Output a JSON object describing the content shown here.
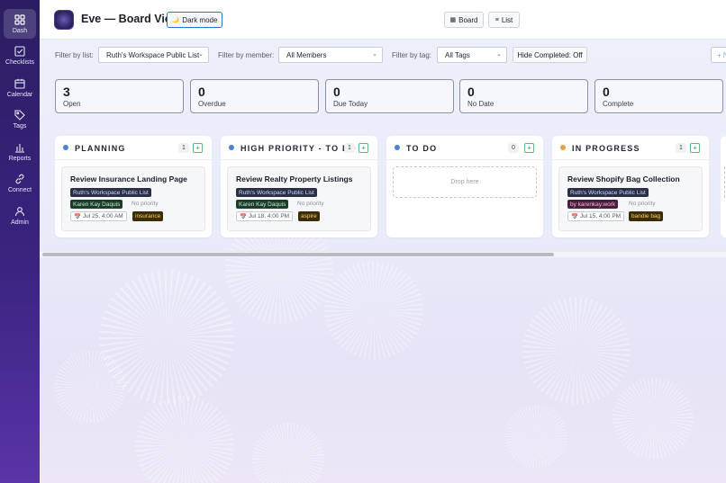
{
  "sidebar": {
    "items": [
      {
        "label": "Dash",
        "icon": "dashboard-icon",
        "active": true
      },
      {
        "label": "Checklists",
        "icon": "checklist-icon",
        "active": false
      },
      {
        "label": "Calendar",
        "icon": "calendar-icon",
        "active": false
      },
      {
        "label": "Tags",
        "icon": "tag-icon",
        "active": false
      },
      {
        "label": "Reports",
        "icon": "bar-chart-icon",
        "active": false
      },
      {
        "label": "Connect",
        "icon": "link-icon",
        "active": false
      },
      {
        "label": "Admin",
        "icon": "user-icon",
        "active": false
      }
    ]
  },
  "header": {
    "title": "Eve — Board View",
    "dark_mode_label": "Dark mode",
    "dark_mode_icon": "🌙",
    "board_label": "Board",
    "board_icon": "▦",
    "list_label": "List",
    "list_icon": "≡"
  },
  "filters": {
    "list_label": "Filter by list:",
    "list_value": "Ruth's Workspace Public List",
    "member_label": "Filter by member:",
    "member_value": "All Members",
    "tag_label": "Filter by tag:",
    "tag_value": "All Tags",
    "hide_completed_label": "Hide Completed: Off",
    "add_label": "+ N"
  },
  "stats": [
    {
      "value": "3",
      "label": "Open"
    },
    {
      "value": "0",
      "label": "Overdue"
    },
    {
      "value": "0",
      "label": "Due Today"
    },
    {
      "value": "0",
      "label": "No Date"
    },
    {
      "value": "0",
      "label": "Complete"
    }
  ],
  "columns": [
    {
      "title": "PLANNING",
      "count": "1",
      "dot_color": "#4a7fd6",
      "card": {
        "title": "Review Insurance Landing Page",
        "list": "Ruth's Workspace Public List",
        "member": "Karen Kay Daquis",
        "priority": "No priority",
        "date": "Jul 25, 4:00 AM",
        "tag": "insurance"
      }
    },
    {
      "title": "HIGH PRIORITY - TO DO",
      "count": "1",
      "dot_color": "#4a7fd6",
      "card": {
        "title": "Review Realty Property Listings",
        "list": "Ruth's Workspace Public List",
        "member": "Karen Kay Daquis",
        "priority": "No priority",
        "date": "Jul 18, 4:00 PM",
        "tag": "aspire"
      }
    },
    {
      "title": "TO DO",
      "count": "0",
      "dot_color": "#4a7fd6",
      "dropzone": "Drop here"
    },
    {
      "title": "IN PROGRESS",
      "count": "1",
      "dot_color": "#e0a23a",
      "card": {
        "title": "Review Shopify Bag Collection",
        "list": "Ruth's Workspace Public List",
        "member": "by karenkay.work",
        "priority": "No priority",
        "date": "Jul 15, 4:00 PM",
        "tag": "bandie bag"
      }
    }
  ],
  "icons": {
    "date": "📅",
    "add": "+",
    "chevron": "⌄"
  }
}
